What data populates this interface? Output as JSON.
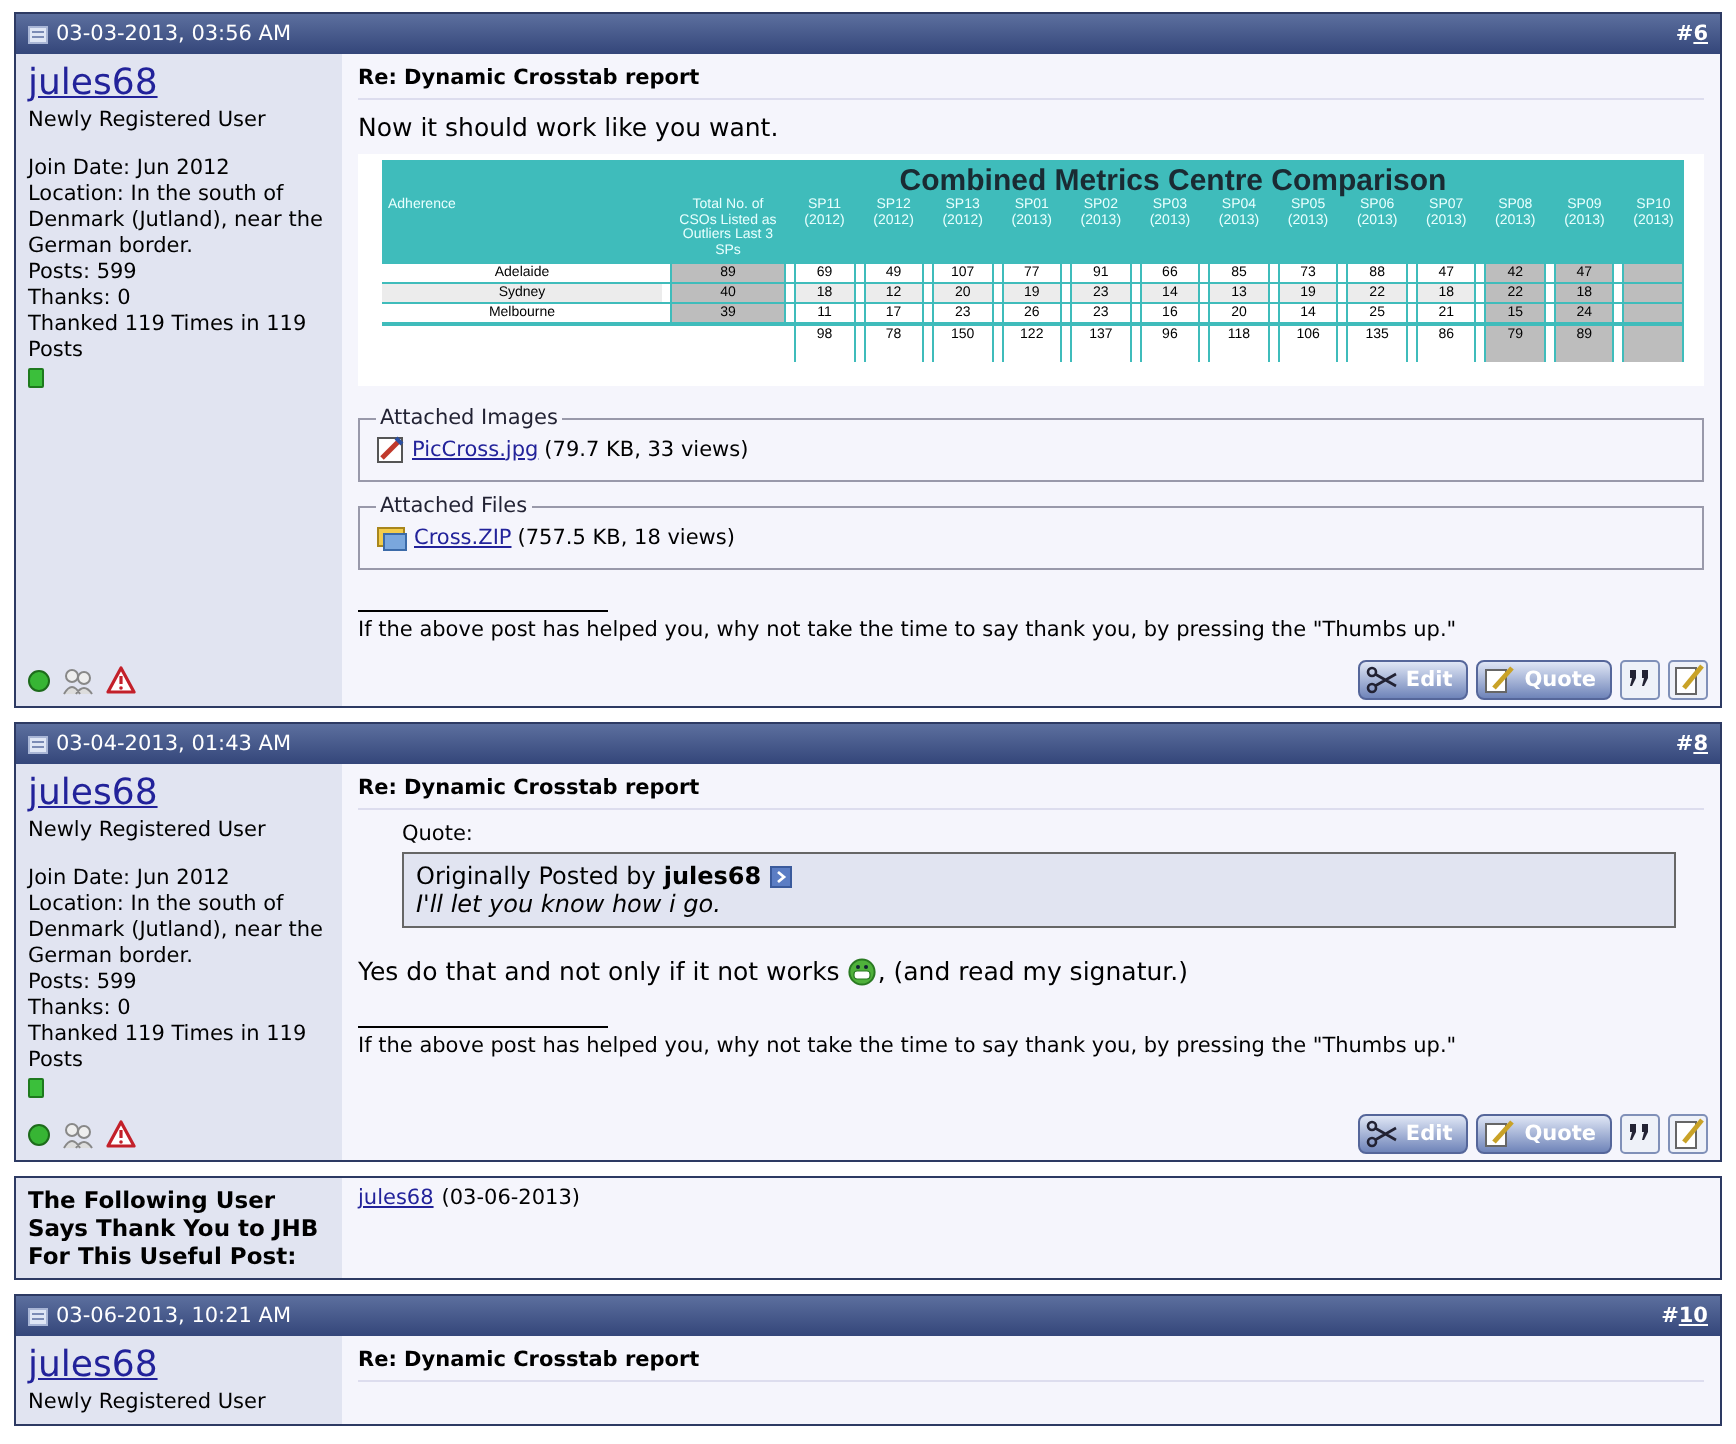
{
  "posts": [
    {
      "date": "03-03-2013, 03:56 AM",
      "hash": "#",
      "number": "6",
      "user": {
        "name": "jules68",
        "title": "Newly Registered User",
        "details": [
          "Join Date: Jun 2012",
          "Location: In the south of Denmark (Jutland), near the German border.",
          "Posts: 599",
          "Thanks: 0",
          "Thanked 119 Times in 119 Posts"
        ],
        "online": true
      },
      "title": "Re: Dynamic Crosstab report",
      "blocks": [
        {
          "kind": "text",
          "text": "Now it should work like you want."
        },
        {
          "kind": "report",
          "title": "Combined Metrics Centre Comparison",
          "columns": [
            {
              "label": "Adherence",
              "shaded": false
            },
            {
              "label": "Total No. of CSOs Listed as Outliers Last 3 SPs",
              "shaded": true
            },
            {
              "label": "SP11 (2012)",
              "shaded": false
            },
            {
              "label": "SP12 (2012)",
              "shaded": false
            },
            {
              "label": "SP13 (2012)",
              "shaded": false
            },
            {
              "label": "SP01 (2013)",
              "shaded": false
            },
            {
              "label": "SP02 (2013)",
              "shaded": false
            },
            {
              "label": "SP03 (2013)",
              "shaded": false
            },
            {
              "label": "SP04 (2013)",
              "shaded": false
            },
            {
              "label": "SP05 (2013)",
              "shaded": false
            },
            {
              "label": "SP06 (2013)",
              "shaded": false
            },
            {
              "label": "SP07 (2013)",
              "shaded": false
            },
            {
              "label": "SP08 (2013)",
              "shaded": true
            },
            {
              "label": "SP09 (2013)",
              "shaded": true
            },
            {
              "label": "SP10 (2013)",
              "shaded": true
            }
          ],
          "rows": [
            {
              "kind": "data",
              "cells": [
                "Adelaide",
                "89",
                "69",
                "49",
                "107",
                "77",
                "91",
                "66",
                "85",
                "73",
                "88",
                "47",
                "42",
                "47",
                null
              ]
            },
            {
              "kind": "data",
              "cells": [
                "Sydney",
                "40",
                "18",
                "12",
                "20",
                "19",
                "23",
                "14",
                "13",
                "19",
                "22",
                "18",
                "22",
                "18",
                null
              ]
            },
            {
              "kind": "data",
              "cells": [
                "Melbourne",
                "39",
                "11",
                "17",
                "23",
                "26",
                "23",
                "16",
                "20",
                "14",
                "25",
                "21",
                "15",
                "24",
                null
              ]
            },
            {
              "kind": "total",
              "cells": [
                "",
                "",
                "98",
                "78",
                "150",
                "122",
                "137",
                "96",
                "118",
                "106",
                "135",
                "86",
                "79",
                "89",
                null
              ]
            }
          ]
        },
        {
          "kind": "image_attachments",
          "legend": "Attached Images",
          "file": "PicCross.jpg",
          "info": "(79.7 KB, 33 views)"
        },
        {
          "kind": "file_attachments",
          "legend": "Attached Files",
          "file": "Cross.ZIP",
          "info": "(757.5 KB, 18 views)"
        }
      ],
      "signature": "If the above post has helped you, why not take the time to say thank you, by pressing the \"Thumbs up.\"",
      "buttons": [
        "Edit",
        "Quote"
      ]
    },
    {
      "date": "03-04-2013, 01:43 AM",
      "hash": "#",
      "number": "8",
      "user": {
        "name": "jules68",
        "title": "Newly Registered User",
        "details": [
          "Join Date: Jun 2012",
          "Location: In the south of Denmark (Jutland), near the German border.",
          "Posts: 599",
          "Thanks: 0",
          "Thanked 119 Times in 119 Posts"
        ],
        "online": true
      },
      "title": "Re: Dynamic Crosstab report",
      "blocks": [
        {
          "kind": "quote",
          "label": "Quote:",
          "prefix": "Originally Posted by",
          "author": "jules68",
          "text": "I'll let you know how i go."
        },
        {
          "kind": "smiley_text",
          "before": "Yes do that and not only if it not works",
          "after": ", (and read my signatur.)"
        }
      ],
      "signature": "If the above post has helped you, why not take the time to say thank you, by pressing the \"Thumbs up.\"",
      "buttons": [
        "Edit",
        "Quote"
      ],
      "thanks": {
        "label": "The Following User Says Thank You to JHB For This Useful Post:",
        "users": [
          {
            "name": "jules68",
            "date": "(03-06-2013)"
          }
        ]
      }
    },
    {
      "date": "03-06-2013, 10:21 AM",
      "hash": "#",
      "number": "10",
      "user": {
        "name": "jules68",
        "title": "Newly Registered User"
      },
      "title": "Re: Dynamic Crosstab report"
    }
  ]
}
